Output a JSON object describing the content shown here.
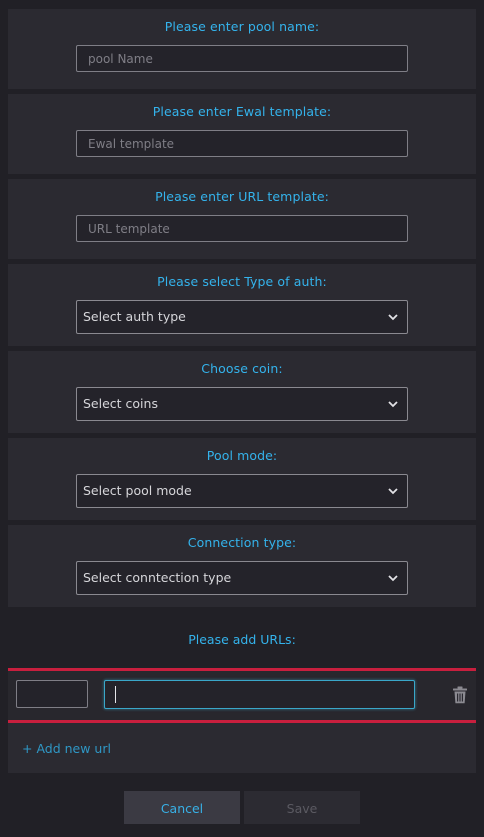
{
  "form": {
    "pool_name": {
      "label": "Please enter pool name:",
      "placeholder": "pool Name",
      "value": ""
    },
    "ewal_template": {
      "label": "Please enter Ewal template:",
      "placeholder": "Ewal template",
      "value": ""
    },
    "url_template": {
      "label": "Please enter URL template:",
      "placeholder": "URL template",
      "value": ""
    },
    "auth_type": {
      "label": "Please select Type of auth:",
      "selected": "Select auth type"
    },
    "coin": {
      "label": "Choose coin:",
      "selected": "Select coins"
    },
    "pool_mode": {
      "label": "Pool mode:",
      "selected": "Select pool mode"
    },
    "connection_type": {
      "label": "Connection type:",
      "selected": "Select conntection type"
    }
  },
  "urls": {
    "label": "Please add URLs:",
    "rows": [
      {
        "port": "",
        "url": ""
      }
    ],
    "add_label": "+ Add new url",
    "delete_icon": "trash-icon"
  },
  "actions": {
    "cancel_label": "Cancel",
    "save_label": "Save"
  },
  "colors": {
    "background": "#212026",
    "card": "#2b2a31",
    "accent": "#34b3ec",
    "row_border": "#c81f3e"
  }
}
